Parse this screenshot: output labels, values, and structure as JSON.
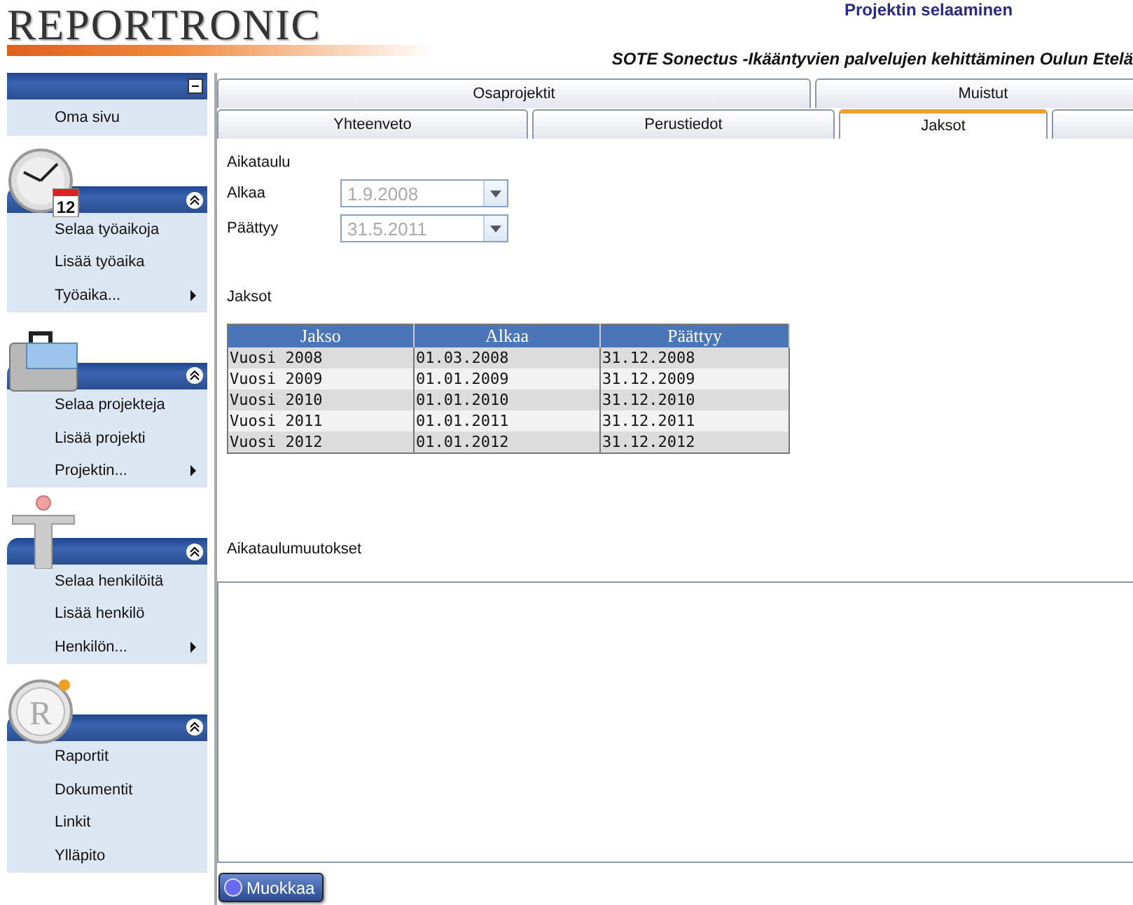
{
  "logo": "REPORTRONIC",
  "page_title": "Projektin selaaminen",
  "project_title": "SOTE Sonectus -Ikääntyvien palvelujen kehittäminen Oulun Etelä",
  "sidebar": [
    {
      "kind": "plain",
      "expanded": true,
      "items": [
        {
          "label": "Oma sivu",
          "submenu": false
        }
      ]
    },
    {
      "kind": "clock",
      "icon_text": "12",
      "expanded": true,
      "items": [
        {
          "label": "Selaa työaikoja",
          "submenu": false
        },
        {
          "label": "Lisää työaika",
          "submenu": false
        },
        {
          "label": "Työaika...",
          "submenu": true
        }
      ]
    },
    {
      "kind": "briefcase",
      "expanded": true,
      "items": [
        {
          "label": "Selaa projekteja",
          "submenu": false
        },
        {
          "label": "Lisää projekti",
          "submenu": false
        },
        {
          "label": "Projektin...",
          "submenu": true
        }
      ]
    },
    {
      "kind": "person",
      "expanded": true,
      "items": [
        {
          "label": "Selaa henkilöitä",
          "submenu": false
        },
        {
          "label": "Lisää henkilö",
          "submenu": false
        },
        {
          "label": "Henkilön...",
          "submenu": true
        }
      ]
    },
    {
      "kind": "emblem",
      "icon_text": "R",
      "expanded": true,
      "items": [
        {
          "label": "Raportit",
          "submenu": false
        },
        {
          "label": "Dokumentit",
          "submenu": false
        },
        {
          "label": "Linkit",
          "submenu": false
        },
        {
          "label": "Ylläpito",
          "submenu": false
        }
      ]
    }
  ],
  "tab_rows": [
    [
      {
        "label": "Osaprojektit",
        "selected": false
      },
      {
        "label": "Muistut",
        "selected": false
      }
    ],
    [
      {
        "label": "Yhteenveto",
        "selected": false
      },
      {
        "label": "Perustiedot",
        "selected": false
      },
      {
        "label": "Jaksot",
        "selected": true
      },
      {
        "selected": false
      }
    ]
  ],
  "schedule": {
    "heading": "Aikataulu",
    "fields": [
      {
        "label": "Alkaa",
        "value": "1.9.2008",
        "disabled": true
      },
      {
        "label": "Päättyy",
        "value": "31.5.2011",
        "disabled": true
      }
    ]
  },
  "periods": {
    "heading": "Jaksot",
    "columns": [
      "Jakso",
      "Alkaa",
      "Päättyy"
    ],
    "rows": [
      [
        "Vuosi 2008",
        "01.03.2008",
        "31.12.2008"
      ],
      [
        "Vuosi 2009",
        "01.01.2009",
        "31.12.2009"
      ],
      [
        "Vuosi 2010",
        "01.01.2010",
        "31.12.2010"
      ],
      [
        "Vuosi 2011",
        "01.01.2011",
        "31.12.2011"
      ],
      [
        "Vuosi 2012",
        "01.01.2012",
        "31.12.2012"
      ]
    ]
  },
  "changes": {
    "label": "Aikataulumuutokset"
  },
  "edit_button": "Muokkaa"
}
